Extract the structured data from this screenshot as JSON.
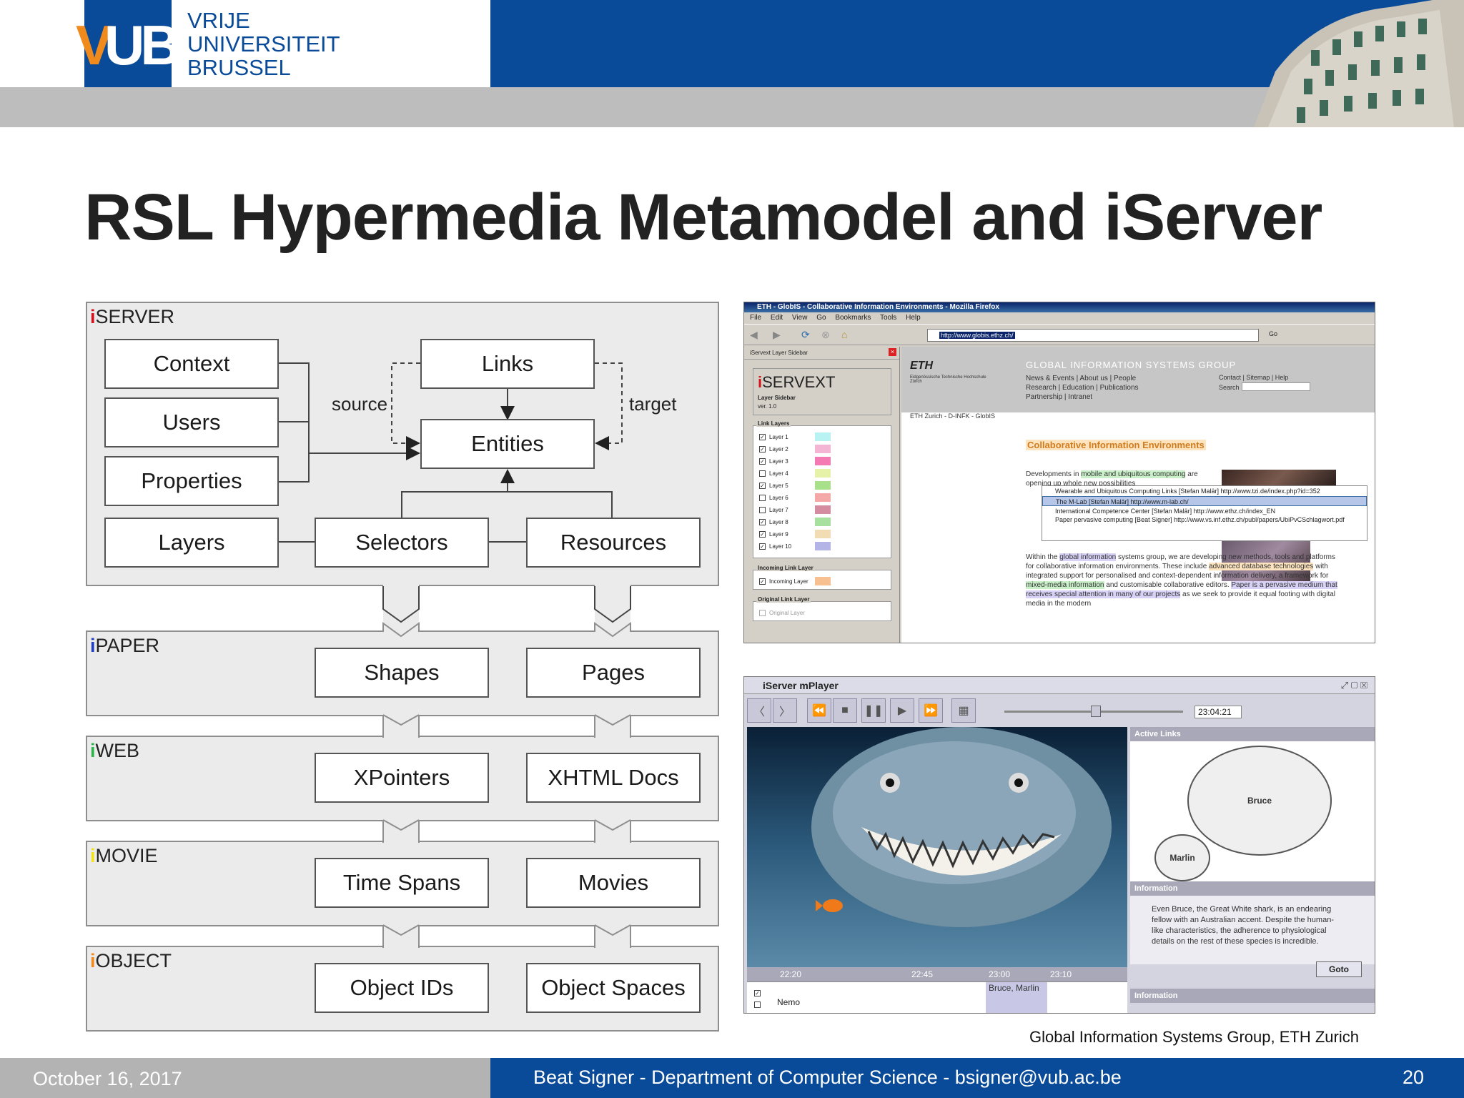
{
  "header": {
    "logo_letters": "VUB",
    "logo_lines": [
      "VRIJE",
      "UNIVERSITEIT",
      "BRUSSEL"
    ],
    "brand_color": "#0a4b99",
    "accent_color": "#f08a1c"
  },
  "slide": {
    "title": "RSL Hypermedia Metamodel and iServer",
    "credit": "Global Information Systems Group, ETH Zurich"
  },
  "diagram": {
    "iserver": {
      "label": "SERVER",
      "boxes": [
        "Context",
        "Users",
        "Properties",
        "Layers",
        "Links",
        "Entities",
        "Selectors",
        "Resources"
      ],
      "edge_source": "source",
      "edge_target": "target"
    },
    "plugins": [
      {
        "label": "PAPER",
        "color": "#1f3fbf",
        "left": "Shapes",
        "right": "Pages"
      },
      {
        "label": "WEB",
        "color": "#2db34a",
        "left": "XPointers",
        "right": "XHTML Docs"
      },
      {
        "label": "MOVIE",
        "color": "#f2e21a",
        "left": "Time Spans",
        "right": "Movies"
      },
      {
        "label": "OBJECT",
        "color": "#f08a1c",
        "left": "Object IDs",
        "right": "Object Spaces"
      }
    ],
    "iserver_color": "#d3141c"
  },
  "browser": {
    "window_title": "ETH - GlobIS - Collaborative Information Environments - Mozilla Firefox",
    "menu": [
      "File",
      "Edit",
      "View",
      "Go",
      "Bookmarks",
      "Tools",
      "Help"
    ],
    "url": "http://www.globis.ethz.ch/",
    "go_label": "Go",
    "sidebar_header": "iServext Layer Sidebar",
    "iservext_title": "SERVEXT",
    "iservext_sub": "Layer Sidebar",
    "iservext_ver": "ver. 1.0",
    "link_layers_title": "Link Layers",
    "layers": [
      {
        "name": "Layer 1",
        "checked": true,
        "color": "#b8f2f2"
      },
      {
        "name": "Layer 2",
        "checked": true,
        "color": "#f4b4d4"
      },
      {
        "name": "Layer 3",
        "checked": true,
        "color": "#f47ab4"
      },
      {
        "name": "Layer 4",
        "checked": false,
        "color": "#e6f2a8"
      },
      {
        "name": "Layer 5",
        "checked": true,
        "color": "#a8e08c"
      },
      {
        "name": "Layer 6",
        "checked": false,
        "color": "#f4a8a8"
      },
      {
        "name": "Layer 7",
        "checked": false,
        "color": "#d48ca0"
      },
      {
        "name": "Layer 8",
        "checked": true,
        "color": "#a8e0a0"
      },
      {
        "name": "Layer 9",
        "checked": true,
        "color": "#f2dcb4"
      },
      {
        "name": "Layer 10",
        "checked": true,
        "color": "#b4b4e6"
      }
    ],
    "incoming_title": "Incoming Link Layer",
    "incoming_layer": "Incoming Layer",
    "incoming_color": "#f8c090",
    "original_title": "Original Link Layer",
    "original_layer": "Original Layer",
    "eth_logo": "ETH",
    "eth_sub": "Eidgenössische Technische Hochschule Zürich",
    "gis_title": "GLOBAL INFORMATION SYSTEMS GROUP",
    "gis_nav_1": "News & Events | About us | People",
    "gis_nav_2": "Research | Education | Publications",
    "gis_nav_3": "Partnership | Intranet",
    "gis_contact": "Contact | Sitemap | Help",
    "search_label": "Search",
    "breadcrumb": "ETH Zurich - D-INFK - GlobIS",
    "page_heading": "Collaborative Information Environments",
    "para1_pre": "Developments in ",
    "para1_hl": "mobile and ubiquitous computing",
    "para1_post": " are opening up whole new possibilities",
    "popup": [
      "Wearable and Ubiquitous Computing Links [Stefan Malär] http://www.tzi.de/index.php?id=352",
      "The M-Lab [Stefan Malär] http://www.m-lab.ch/",
      "International Competence Center [Stefan Malär] http://www.ethz.ch/index_EN",
      "Paper pervasive computing [Beat Signer] http://www.vs.inf.ethz.ch/publ/papers/UbiPvCSchlagwort.pdf"
    ],
    "para2_a": "Within the ",
    "para2_hl1": "global information",
    "para2_b": " systems group, we are developing new methods, tools and platforms for collaborative information environments. These include ",
    "para2_hl2": "advanced database technologies",
    "para2_c": " with integrated support for personalised and context-dependent information delivery, a framework for ",
    "para2_hl3": "mixed-media information",
    "para2_d": " and customisable collaborative editors. ",
    "para2_hl4": "Paper is a pervasive medium that receives special attention in many of our projects",
    "para2_e": " as we seek to provide it equal footing with digital media in the modern"
  },
  "player": {
    "window_title": "iServer mPlayer",
    "time": "23:04:21",
    "slider_position": 0.51,
    "active_links_title": "Active Links",
    "links": [
      "Bruce",
      "Marlin"
    ],
    "information_title": "Information",
    "information_text": "Even Bruce, the Great White shark, is an endearing fellow with an Australian accent. Despite the human-like characteristics, the adherence to physiological details on the rest of these species is incredible.",
    "goto_label": "Goto",
    "information_title_2": "Information",
    "timeline_ticks": [
      "22:20",
      "22:45",
      "23:00",
      "23:10"
    ],
    "timeline_rows": [
      {
        "checked": true,
        "label": ""
      },
      {
        "checked": false,
        "label": "Nemo"
      }
    ],
    "timeline_event": "Bruce, Marlin"
  },
  "footer": {
    "date": "October 16, 2017",
    "author": "Beat Signer - Department of Computer Science - bsigner@vub.ac.be",
    "page": "20"
  }
}
